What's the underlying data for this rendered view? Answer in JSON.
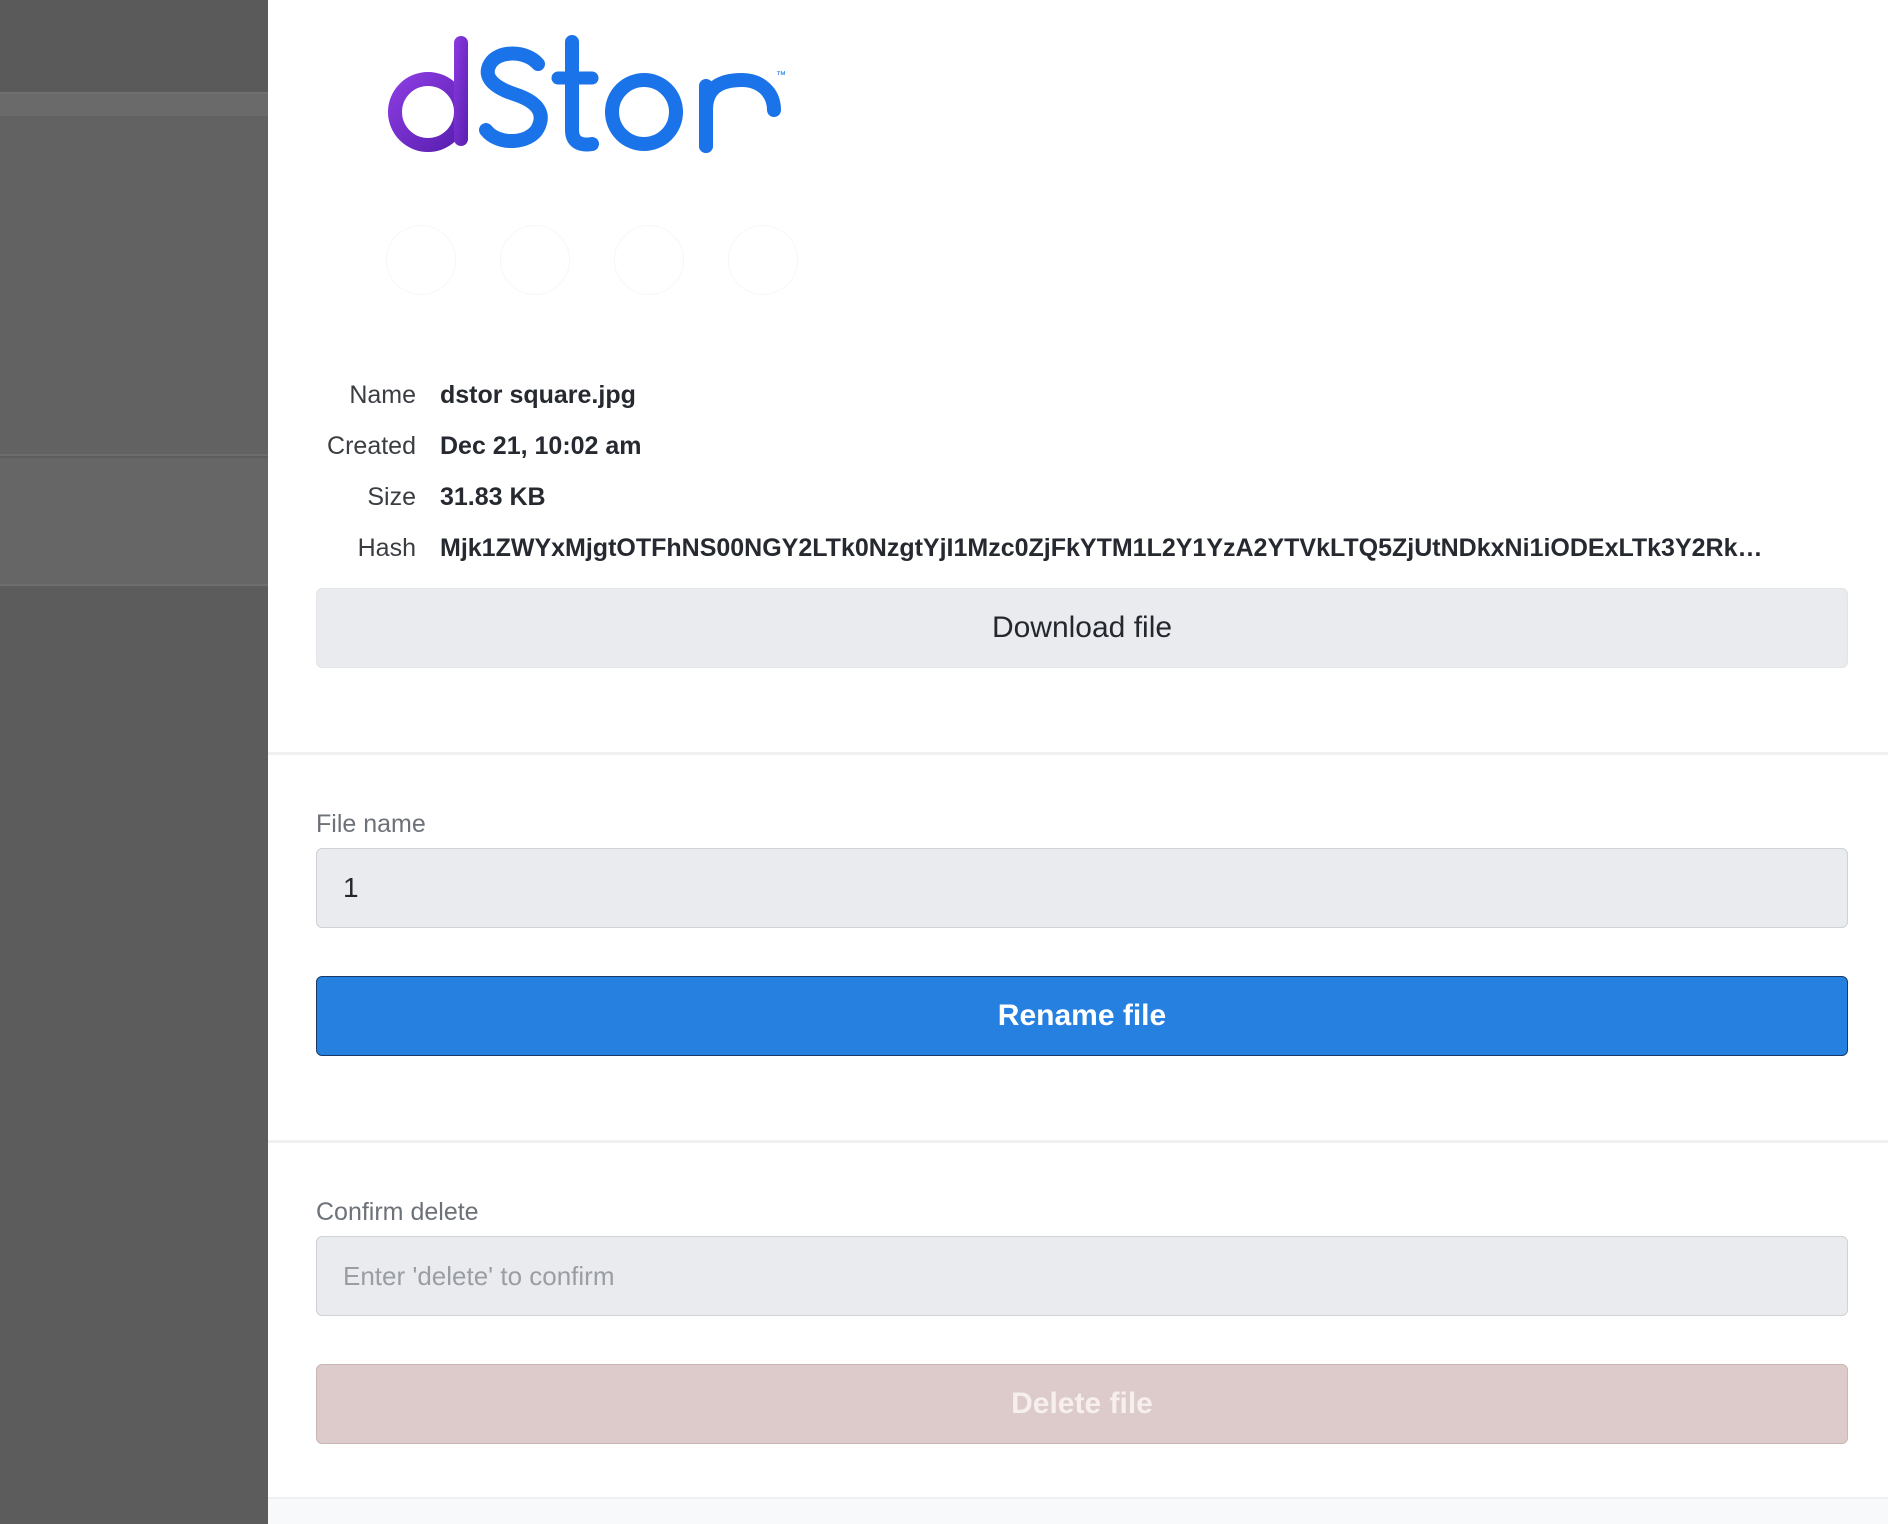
{
  "brand": {
    "logo_text_d": "d",
    "logo_text_rest": "Stor",
    "trademark": "™",
    "gradient_start": "#6a2bc8",
    "gradient_end": "#5a1fb0",
    "brand_blue": "#1a73e8"
  },
  "file_info": {
    "rows": [
      {
        "label": "Name",
        "value": "dstor square.jpg"
      },
      {
        "label": "Created",
        "value": "Dec 21, 10:02 am"
      },
      {
        "label": "Size",
        "value": "31.83 KB"
      },
      {
        "label": "Hash",
        "value": "Mjk1ZWYxMjgtOTFhNS00NGY2LTk0NzgtYjI1Mzc0ZjFkYTM1L2Y1YzA2YTVkLTQ5ZjUtNDkxNi1iODExLTk3Y2Rk…"
      }
    ]
  },
  "actions": {
    "download_label": "Download file",
    "rename_label": "Rename file",
    "delete_label": "Delete file"
  },
  "rename_form": {
    "label": "File name",
    "value": "1"
  },
  "delete_form": {
    "label": "Confirm delete",
    "placeholder": "Enter 'delete' to confirm",
    "value": ""
  },
  "colors": {
    "rename_button": "#2680e0",
    "delete_button_disabled": "#dccbca",
    "overlay": "#5b5b5b"
  }
}
